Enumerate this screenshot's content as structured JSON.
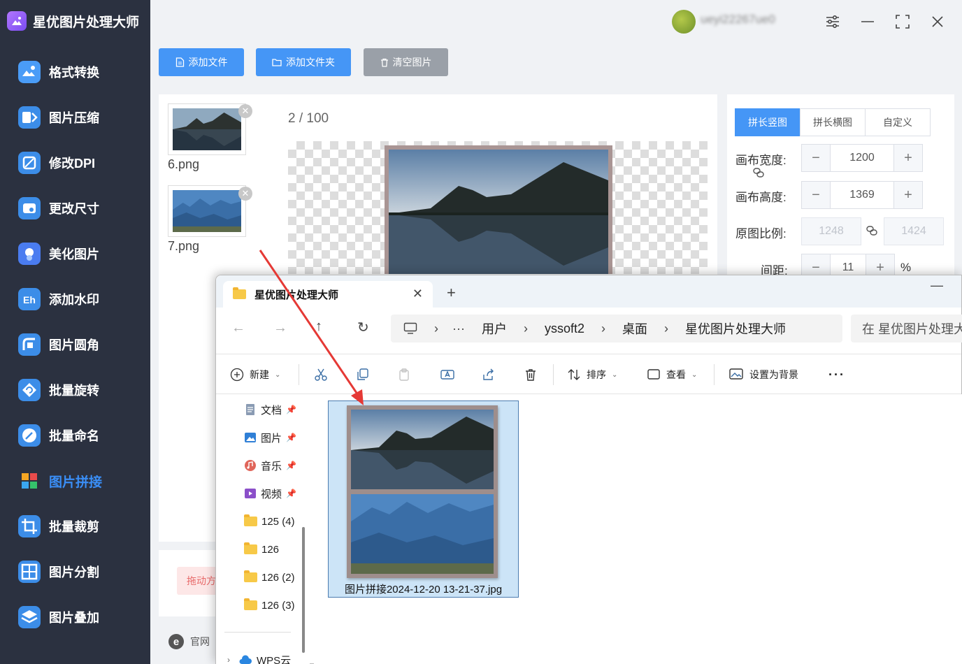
{
  "app": {
    "title": "星优图片处理大师",
    "user_name": "ueyi22267ue0"
  },
  "sidebar": {
    "items": [
      {
        "label": "格式转换",
        "icon": "image-convert-icon",
        "color": "#4a9cf7"
      },
      {
        "label": "图片压缩",
        "icon": "compress-icon",
        "color": "#3c8de8"
      },
      {
        "label": "修改DPI",
        "icon": "dpi-icon",
        "color": "#3c8de8"
      },
      {
        "label": "更改尺寸",
        "icon": "resize-icon",
        "color": "#3c8de8"
      },
      {
        "label": "美化图片",
        "icon": "beautify-icon",
        "color": "#4a7cf0"
      },
      {
        "label": "添加水印",
        "icon": "watermark-icon",
        "color": "#3c8de8"
      },
      {
        "label": "图片圆角",
        "icon": "round-corner-icon",
        "color": "#3c8de8"
      },
      {
        "label": "批量旋转",
        "icon": "rotate-icon",
        "color": "#3c8de8"
      },
      {
        "label": "批量命名",
        "icon": "rename-icon",
        "color": "#3c8de8"
      },
      {
        "label": "图片拼接",
        "icon": "stitch-icon",
        "color": "#3a8ef6",
        "active": true
      },
      {
        "label": "批量裁剪",
        "icon": "crop-icon",
        "color": "#3c8de8"
      },
      {
        "label": "图片分割",
        "icon": "split-icon",
        "color": "#3c8de8"
      },
      {
        "label": "图片叠加",
        "icon": "layer-icon",
        "color": "#3c8de8"
      }
    ]
  },
  "toolbar": {
    "add_file": "添加文件",
    "add_folder": "添加文件夹",
    "clear_images": "清空图片"
  },
  "files": [
    {
      "name": "6.png"
    },
    {
      "name": "7.png"
    }
  ],
  "preview": {
    "counter_current": "2",
    "counter_sep": " / ",
    "counter_total": "100"
  },
  "bottom": {
    "drag_hint": "拖动方",
    "site_label": "官网"
  },
  "settings": {
    "tabs": [
      "拼长竖图",
      "拼长横图",
      "自定义"
    ],
    "active_tab": 0,
    "canvas_width_label": "画布宽度:",
    "canvas_width": "1200",
    "canvas_height_label": "画布高度:",
    "canvas_height": "1369",
    "ratio_label": "原图比例:",
    "ratio_w": "1248",
    "ratio_h": "1424",
    "spacing_label": "间距:",
    "spacing": "11",
    "spacing_unit": "%"
  },
  "explorer": {
    "tab_title": "星优图片处理大师",
    "breadcrumb": [
      "用户",
      "yssoft2",
      "桌面",
      "星优图片处理大师"
    ],
    "search_placeholder": "在 星优图片处理大",
    "commands": {
      "new": "新建",
      "sort": "排序",
      "view": "查看",
      "set_background": "设置为背景"
    },
    "nav": [
      {
        "label": "文档",
        "icon": "documents-icon",
        "pinned": true
      },
      {
        "label": "图片",
        "icon": "pictures-icon",
        "pinned": true
      },
      {
        "label": "音乐",
        "icon": "music-icon",
        "pinned": true
      },
      {
        "label": "视频",
        "icon": "video-icon",
        "pinned": true
      },
      {
        "label": "125 (4)",
        "icon": "folder-icon"
      },
      {
        "label": "126",
        "icon": "folder-icon"
      },
      {
        "label": "126 (2)",
        "icon": "folder-icon"
      },
      {
        "label": "126 (3)",
        "icon": "folder-icon"
      },
      {
        "label": "WPS云",
        "icon": "cloud-icon"
      }
    ],
    "file": {
      "name": "图片拼接2024-12-20 13-21-37.jpg"
    }
  },
  "colors": {
    "sidebar_bg": "#2b3140",
    "accent": "#4596f6",
    "arrow": "#e53935"
  }
}
